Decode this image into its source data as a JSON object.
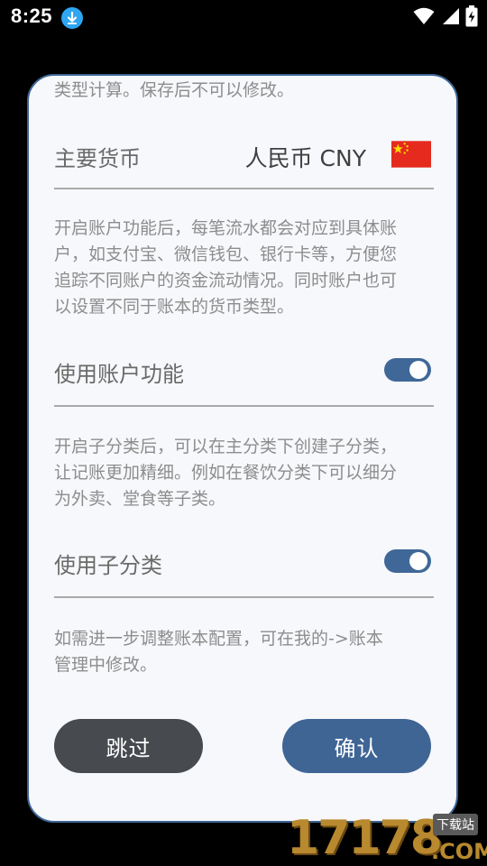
{
  "status_bar": {
    "time": "8:25",
    "icons": [
      "download-icon",
      "wifi-icon",
      "signal-icon",
      "battery-charging-icon"
    ]
  },
  "dialog": {
    "top_text": "类型计算。保存后不可以修改。",
    "currency": {
      "label": "主要货币",
      "value": "人民币 CNY",
      "flag": "china-flag-icon"
    },
    "account": {
      "description_lines": [
        "开启账户功能后，每笔流水都会对应到具体账",
        "户，如支付宝、微信钱包、银行卡等，方便您",
        "追踪不同账户的资金流动情况。同时账户也可",
        "以设置不同于账本的货币类型。"
      ],
      "label": "使用账户功能",
      "enabled": true
    },
    "subcategory": {
      "description_lines": [
        "开启子分类后，可以在主分类下创建子分类，",
        "让记账更加精细。例如在餐饮分类下可以细分",
        "为外卖、堂食等子类。"
      ],
      "label": "使用子分类",
      "enabled": true
    },
    "footer_note_lines": [
      "如需进一步调整账本配置，可在我的->账本",
      "管理中修改。"
    ],
    "skip_label": "跳过",
    "confirm_label": "确认"
  },
  "watermark": {
    "number": "17178",
    "domain": ".COM",
    "tag": "下载站"
  },
  "colors": {
    "accent": "#3f6595",
    "dialog_bg": "#f6f8fb",
    "skip_button": "#474a4f",
    "watermark": "#b8892e"
  }
}
